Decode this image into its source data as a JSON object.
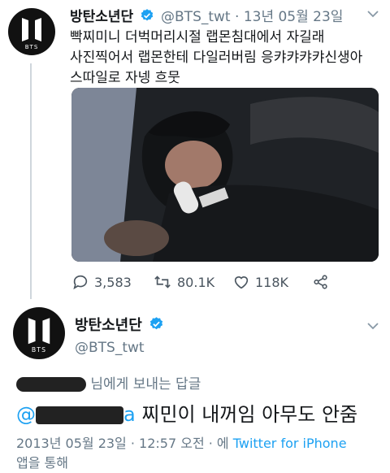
{
  "first_tweet": {
    "name": "방탄소년단",
    "handle": "@BTS_twt",
    "separator": "·",
    "date": "13년 05월 23일",
    "text": "빡찌미니 더벅머리시절 랩몬침대에서 자길래\n사진찍어서 랩몬한테 다일러버림 응캬캬캬캬신생아\n스따일로 자넹 흐뭇",
    "replies": "3,583",
    "retweets": "80.1K",
    "likes": "118K",
    "avatar_text": "BTS"
  },
  "second_tweet": {
    "name": "방탄소년단",
    "handle": "@BTS_twt",
    "avatar_text": "BTS",
    "reply_to_suffix": "님에게 보내는 답글",
    "mention_prefix": "@",
    "mention_tail": "a",
    "text": "찌민이 내꺼임 아무도 안줌",
    "timestamp": "2013년 05월 23일 · 12:57 오전 · 에",
    "source": "Twitter for iPhone",
    "via": "앱을 통해"
  },
  "colors": {
    "link": "#1da1f2",
    "verified": "#1da1f2",
    "meta": "#657786"
  },
  "icons": [
    "bts-logo",
    "verified-badge",
    "chevron-down-icon",
    "reply-icon",
    "retweet-icon",
    "like-icon",
    "share-icon"
  ]
}
